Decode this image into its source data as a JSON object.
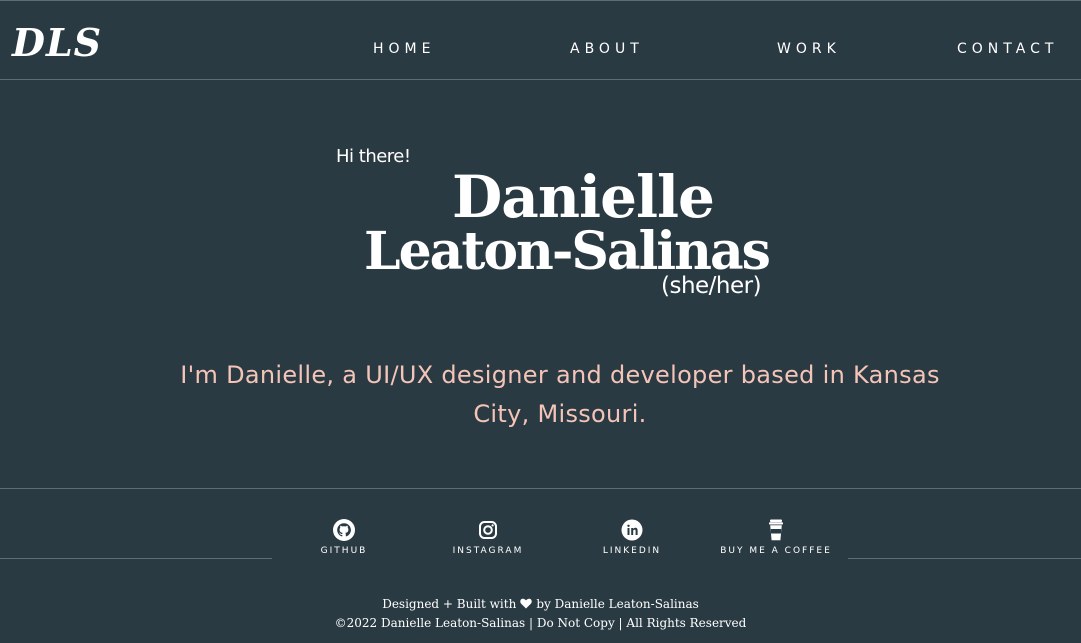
{
  "header": {
    "logo": "DLS",
    "nav": [
      {
        "label": "HOME"
      },
      {
        "label": "ABOUT"
      },
      {
        "label": "WORK"
      },
      {
        "label": "CONTACT"
      }
    ]
  },
  "hero": {
    "greeting": "Hi there!",
    "name_first": "Danielle",
    "name_last": "Leaton-Salinas",
    "pronouns": "(she/her)",
    "intro_line1": "I'm Danielle, a UI/UX designer and developer based in Kansas",
    "intro_line2": "City, Missouri."
  },
  "social": [
    {
      "label": "GITHUB",
      "icon": "github-icon"
    },
    {
      "label": "INSTAGRAM",
      "icon": "instagram-icon"
    },
    {
      "label": "LINKEDIN",
      "icon": "linkedin-icon"
    },
    {
      "label": "BUY ME A COFFEE",
      "icon": "coffee-cup-icon"
    }
  ],
  "footer": {
    "built_prefix": "Designed + Built with",
    "built_suffix": "by Danielle Leaton-Salinas",
    "copyright": "©2022 Danielle Leaton-Salinas | Do Not Copy | All Rights Reserved"
  },
  "colors": {
    "background": "#2a3a42",
    "accent": "#f4c4b8",
    "text": "#ffffff",
    "divider": "#5d6d74"
  }
}
